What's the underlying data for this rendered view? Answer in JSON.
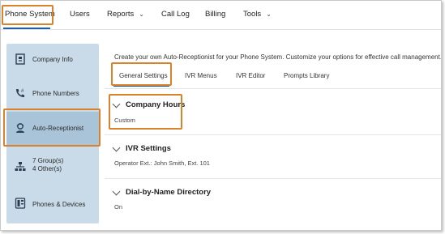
{
  "nav": {
    "items": [
      {
        "label": "Phone System"
      },
      {
        "label": "Users"
      },
      {
        "label": "Reports",
        "has_dropdown": true
      },
      {
        "label": "Call Log"
      },
      {
        "label": "Billing"
      },
      {
        "label": "Tools",
        "has_dropdown": true
      }
    ],
    "active": "Phone System"
  },
  "sidebar": {
    "items": [
      {
        "label": "Company Info",
        "icon": "company-info-icon"
      },
      {
        "label": "Phone Numbers",
        "icon": "phone-numbers-icon"
      },
      {
        "label": "Auto-Receptionist",
        "icon": "auto-receptionist-icon",
        "active": true
      },
      {
        "label_line1": "7 Group(s)",
        "label_line2": "4 Other(s)",
        "icon": "groups-icon"
      },
      {
        "label": "Phones & Devices",
        "icon": "phones-devices-icon"
      }
    ]
  },
  "main": {
    "intro": "Create your own Auto-Receptionist for your Phone System. Customize your options for effective call management.",
    "tabs": [
      {
        "label": "General Settings",
        "active": true
      },
      {
        "label": "IVR Menus"
      },
      {
        "label": "IVR Editor"
      },
      {
        "label": "Prompts Library"
      }
    ],
    "sections": [
      {
        "title": "Company Hours",
        "value": "Custom"
      },
      {
        "title": "IVR Settings",
        "value": "Operator Ext.: John Smith, Ext. 101"
      },
      {
        "title": "Dial-by-Name Directory",
        "value": "On"
      }
    ]
  },
  "colors": {
    "highlight": "#d9822b",
    "accent": "#1f5fa8",
    "sidebar_bg": "#c9dbe8",
    "sidebar_active": "#a9c4d8"
  }
}
